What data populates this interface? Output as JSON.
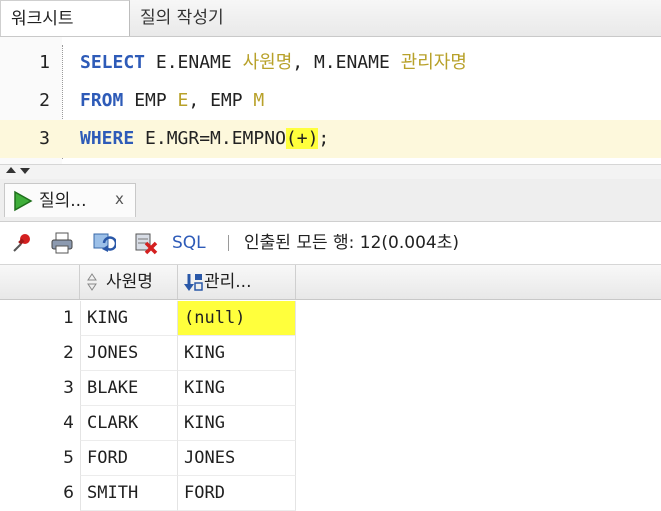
{
  "tabs": {
    "worksheet": "워크시트",
    "query_builder": "질의 작성기"
  },
  "editor": {
    "line_numbers": [
      "1",
      "2",
      "3"
    ],
    "line1": {
      "kw": "SELECT",
      "t1": " E.ENAME ",
      "a1": "사원명",
      "t2": ", M.ENAME ",
      "a2": "관리자명"
    },
    "line2": {
      "kw": "FROM",
      "t1": " EMP ",
      "a1": "E",
      "t2": ", EMP ",
      "a2": "M"
    },
    "line3": {
      "kw": "WHERE",
      "t1": " E.MGR=M.EMPNO",
      "hl": "(+)",
      "t2": ";"
    }
  },
  "result_tab": {
    "label": "질의...",
    "close": "x"
  },
  "toolbar": {
    "sql_label": "SQL",
    "status": "인출된 모든 행: 12(0.004초)"
  },
  "grid": {
    "columns": [
      "사원명",
      "관리..."
    ],
    "rows": [
      {
        "num": "1",
        "c1": "KING",
        "c2": "(null)"
      },
      {
        "num": "2",
        "c1": "JONES",
        "c2": "KING"
      },
      {
        "num": "3",
        "c1": "BLAKE",
        "c2": "KING"
      },
      {
        "num": "4",
        "c1": "CLARK",
        "c2": "KING"
      },
      {
        "num": "5",
        "c1": "FORD",
        "c2": "JONES"
      },
      {
        "num": "6",
        "c1": "SMITH",
        "c2": "FORD"
      }
    ]
  },
  "icons": [
    "pin-icon",
    "print-icon",
    "refresh-icon",
    "delete-icon",
    "run-icon",
    "sort-icon",
    "sort-desc-icon"
  ],
  "colors": {
    "keyword": "#2e5bb8",
    "alias": "#b8a12a",
    "highlight": "#ffff3c",
    "current_line": "#fdf8dc"
  }
}
